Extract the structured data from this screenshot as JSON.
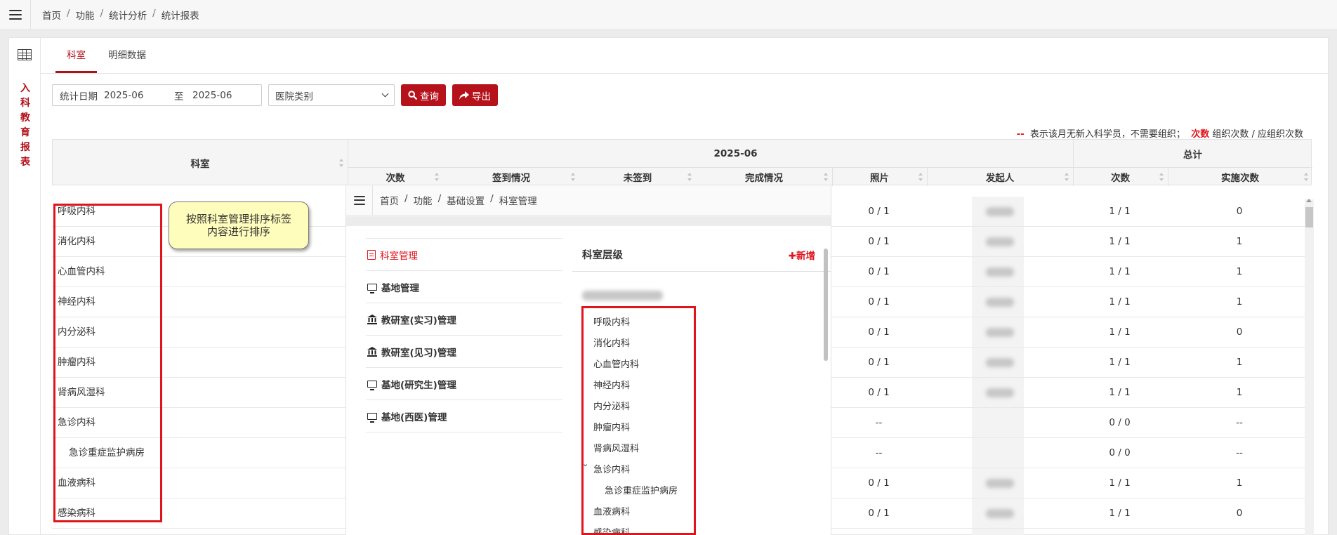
{
  "breadcrumb": [
    "首页",
    "功能",
    "统计分析",
    "统计报表"
  ],
  "sidebar": {
    "vertical_title": [
      "入",
      "科",
      "教",
      "育",
      "报",
      "表"
    ]
  },
  "tabs": [
    {
      "label": "科室",
      "active": true
    },
    {
      "label": "明细数据",
      "active": false
    }
  ],
  "filters": {
    "date_label": "统计日期",
    "date_start": "2025-06",
    "date_to": "至",
    "date_end": "2025-06",
    "category_select": "医院类别",
    "query_button": "查询",
    "export_button": "导出"
  },
  "legend": {
    "dash": "--",
    "dash_desc": "表示该月无新入科学员，不需要组织；",
    "count": "次数",
    "count_desc": "组织次数 / 应组织次数"
  },
  "table": {
    "headers": {
      "dept": "科室",
      "month_group": "2025-06",
      "total_group": "总计",
      "count": "次数",
      "sign": "签到情况",
      "unsigned": "未签到",
      "completion": "完成情况",
      "photo": "照片",
      "initiator": "发起人",
      "total_count": "次数",
      "implemented": "实施次数"
    },
    "rows": [
      {
        "dept": "呼吸内科",
        "sub": false,
        "photo": "0 / 1",
        "total": "1 / 1",
        "impl": "0",
        "blurred": true
      },
      {
        "dept": "消化内科",
        "sub": false,
        "photo": "0 / 1",
        "total": "1 / 1",
        "impl": "1",
        "blurred": true
      },
      {
        "dept": "心血管内科",
        "sub": false,
        "photo": "0 / 1",
        "total": "1 / 1",
        "impl": "1",
        "blurred": true
      },
      {
        "dept": "神经内科",
        "sub": false,
        "photo": "0 / 1",
        "total": "1 / 1",
        "impl": "1",
        "blurred": true
      },
      {
        "dept": "内分泌科",
        "sub": false,
        "photo": "0 / 1",
        "total": "1 / 1",
        "impl": "0",
        "blurred": true
      },
      {
        "dept": "肿瘤内科",
        "sub": false,
        "photo": "0 / 1",
        "total": "1 / 1",
        "impl": "1",
        "blurred": true
      },
      {
        "dept": "肾病风湿科",
        "sub": false,
        "photo": "0 / 1",
        "total": "1 / 1",
        "impl": "1",
        "blurred": true
      },
      {
        "dept": "急诊内科",
        "sub": false,
        "photo": "--",
        "total": "0 / 0",
        "impl": "--",
        "blurred": false
      },
      {
        "dept": "急诊重症监护病房",
        "sub": true,
        "photo": "--",
        "total": "0 / 0",
        "impl": "--",
        "blurred": false
      },
      {
        "dept": "血液病科",
        "sub": false,
        "photo": "0 / 1",
        "total": "1 / 1",
        "impl": "1",
        "blurred": true
      },
      {
        "dept": "感染病科",
        "sub": false,
        "photo": "0 / 1",
        "total": "1 / 1",
        "impl": "0",
        "blurred": true
      }
    ]
  },
  "callout": "按照科室管理排序标签内容进行排序",
  "overlay": {
    "breadcrumb": [
      "首页",
      "功能",
      "基础设置",
      "科室管理"
    ],
    "side_items": [
      {
        "label": "科室管理",
        "icon": "document-icon",
        "active": true
      },
      {
        "label": "基地管理",
        "icon": "monitor-icon",
        "active": false
      },
      {
        "label": "教研室(实习)管理",
        "icon": "bank-icon",
        "active": false
      },
      {
        "label": "教研室(见习)管理",
        "icon": "bank-icon",
        "active": false
      },
      {
        "label": "基地(研究生)管理",
        "icon": "monitor-icon",
        "active": false
      },
      {
        "label": "基地(西医)管理",
        "icon": "monitor-icon",
        "active": false
      }
    ],
    "panel_title": "科室层级",
    "add_button": "✚新增",
    "tree_items": [
      {
        "label": "呼吸内科",
        "sub": false
      },
      {
        "label": "消化内科",
        "sub": false
      },
      {
        "label": "心血管内科",
        "sub": false
      },
      {
        "label": "神经内科",
        "sub": false
      },
      {
        "label": "内分泌科",
        "sub": false
      },
      {
        "label": "肿瘤内科",
        "sub": false
      },
      {
        "label": "肾病风湿科",
        "sub": false
      },
      {
        "label": "急诊内科",
        "sub": false,
        "expanded": true
      },
      {
        "label": "急诊重症监护病房",
        "sub": true
      },
      {
        "label": "血液病科",
        "sub": false
      },
      {
        "label": "感染病科",
        "sub": false
      }
    ]
  },
  "colors": {
    "brand": "#b5121b",
    "highlight": "#e0141d",
    "callout_bg": "#fffdbb"
  }
}
